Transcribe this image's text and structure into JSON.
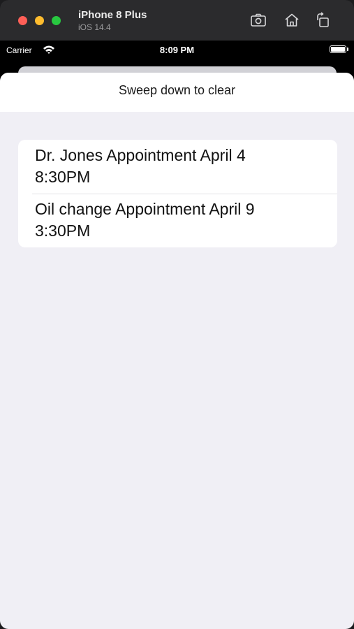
{
  "simulator": {
    "device_name": "iPhone 8 Plus",
    "os_version": "iOS 14.4",
    "toolbar_icons": [
      "screenshot-icon",
      "home-icon",
      "rotate-icon"
    ]
  },
  "status_bar": {
    "carrier": "Carrier",
    "time": "8:09 PM",
    "battery_level": 1.0
  },
  "nav": {
    "title": "Sweep down to clear"
  },
  "appointments": [
    {
      "line1": "Dr. Jones Appointment April 4",
      "line2": "8:30PM"
    },
    {
      "line1": "Oil change Appointment April 9",
      "line2": "3:30PM"
    }
  ],
  "colors": {
    "close": "#ff5f57",
    "minimize": "#febc2e",
    "maximize": "#28c840",
    "background": "#f0eff5"
  }
}
